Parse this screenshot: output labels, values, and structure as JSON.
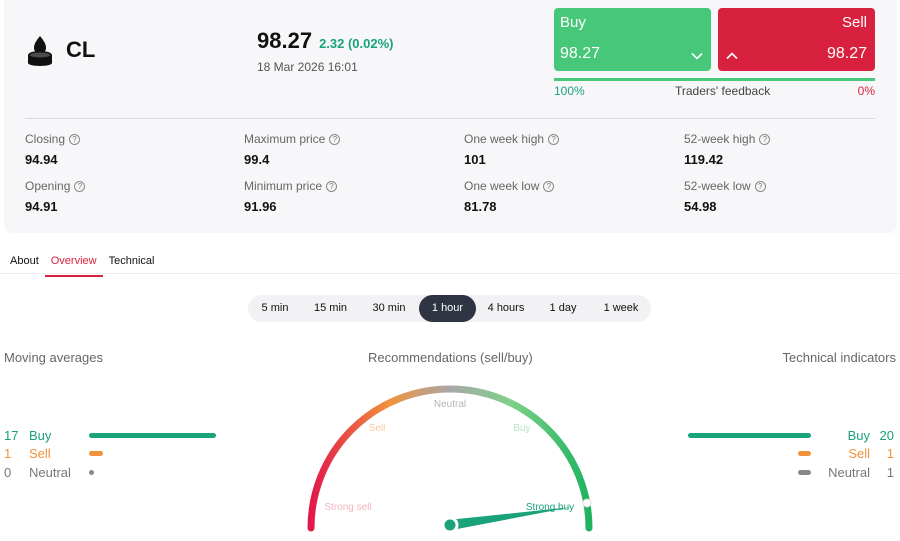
{
  "instrument": {
    "symbol": "CL",
    "icon": "oil-barrel-icon"
  },
  "quote": {
    "price": "98.27",
    "change": "2.32 (0.02%)",
    "datetime": "18 Mar 2026 16:01"
  },
  "trade": {
    "buy_label": "Buy",
    "buy_price": "98.27",
    "sell_label": "Sell",
    "sell_price": "98.27"
  },
  "feedback": {
    "title": "Traders' feedback",
    "buy_pct": "100%",
    "sell_pct": "0%",
    "buy_fraction": 1.0
  },
  "stats": [
    {
      "label": "Closing",
      "value": "94.94"
    },
    {
      "label": "Maximum price",
      "value": "99.4"
    },
    {
      "label": "One week high",
      "value": "101"
    },
    {
      "label": "52-week high",
      "value": "119.42"
    },
    {
      "label": "Opening",
      "value": "94.91"
    },
    {
      "label": "Minimum price",
      "value": "91.96"
    },
    {
      "label": "One week low",
      "value": "81.78"
    },
    {
      "label": "52-week low",
      "value": "54.98"
    }
  ],
  "tabs": [
    {
      "label": "About",
      "active": false
    },
    {
      "label": "Overview",
      "active": true
    },
    {
      "label": "Technical",
      "active": false
    }
  ],
  "periods": [
    {
      "label": "5 min",
      "active": false
    },
    {
      "label": "15 min",
      "active": false
    },
    {
      "label": "30 min",
      "active": false
    },
    {
      "label": "1 hour",
      "active": true
    },
    {
      "label": "4 hours",
      "active": false
    },
    {
      "label": "1 day",
      "active": false
    },
    {
      "label": "1 week",
      "active": false
    }
  ],
  "moving_averages": {
    "title": "Moving averages",
    "buy": {
      "count": "17",
      "label": "Buy"
    },
    "sell": {
      "count": "1",
      "label": "Sell"
    },
    "neutral": {
      "count": "0",
      "label": "Neutral"
    }
  },
  "recommendations": {
    "title": "Recommendations (sell/buy)",
    "labels": {
      "strong_sell": "Strong sell",
      "sell": "Sell",
      "neutral": "Neutral",
      "buy": "Buy",
      "strong_buy": "Strong buy"
    },
    "active": "Strong buy"
  },
  "technical_indicators": {
    "title": "Technical indicators",
    "buy": {
      "count": "20",
      "label": "Buy"
    },
    "sell": {
      "count": "1",
      "label": "Sell"
    },
    "neutral": {
      "count": "1",
      "label": "Neutral"
    }
  },
  "colors": {
    "buy": "#46c779",
    "sell": "#d8213f",
    "ma_buy": "#1aa27a",
    "ma_sell": "#f0923c",
    "neutral": "#888888"
  }
}
